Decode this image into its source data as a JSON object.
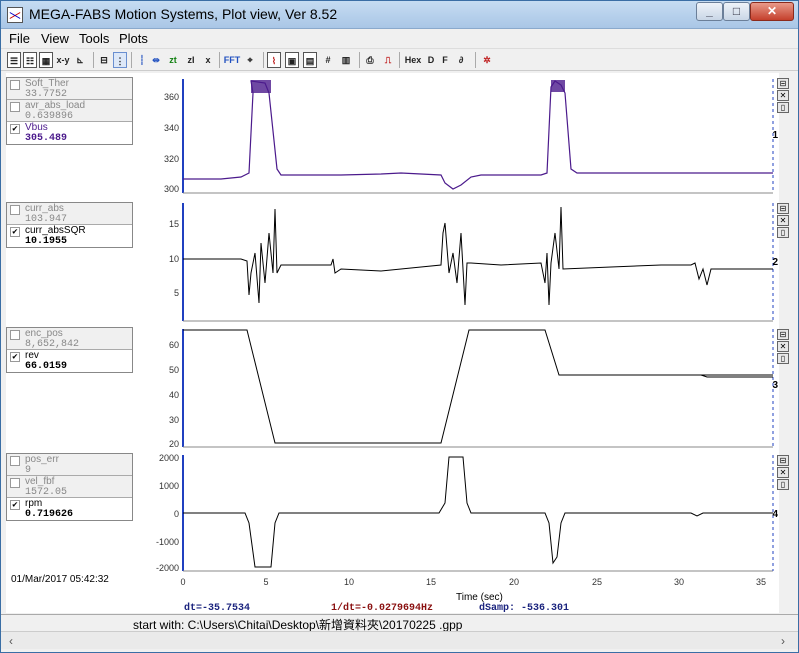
{
  "window": {
    "title": "MEGA-FABS Motion Systems, Plot view, Ver 8.52"
  },
  "menu": [
    "File",
    "View",
    "Tools",
    "Plots"
  ],
  "toolbar": {
    "xy": "x-y",
    "zt": "zt",
    "zi": "zI",
    "fft": "FFT",
    "hex": "Hex",
    "d": "D",
    "f": "F"
  },
  "plots": [
    {
      "number": "1",
      "signals": [
        {
          "name": "Soft_Ther",
          "value": "33.7752",
          "checked": false
        },
        {
          "name": "avr_abs_load",
          "value": "0.639896",
          "checked": false
        },
        {
          "name": "Vbus",
          "value": "305.489",
          "checked": true
        }
      ],
      "yticks": [
        "360",
        "340",
        "320",
        "300"
      ]
    },
    {
      "number": "2",
      "signals": [
        {
          "name": "curr_abs",
          "value": "103.947",
          "checked": false
        },
        {
          "name": "curr_absSQR",
          "value": "10.1955",
          "checked": true
        }
      ],
      "yticks": [
        "15",
        "10",
        "5"
      ]
    },
    {
      "number": "3",
      "signals": [
        {
          "name": "enc_pos",
          "value": "8,652,842",
          "checked": false
        },
        {
          "name": "rev",
          "value": "66.0159",
          "checked": true
        }
      ],
      "yticks": [
        "60",
        "50",
        "40",
        "30",
        "20"
      ]
    },
    {
      "number": "4",
      "signals": [
        {
          "name": "pos_err",
          "value": "9",
          "checked": false
        },
        {
          "name": "vel_fbf",
          "value": "1572.05",
          "checked": false
        },
        {
          "name": "rpm",
          "value": "0.719626",
          "checked": true
        }
      ],
      "yticks": [
        "2000",
        "1000",
        "0",
        "-1000",
        "-2000"
      ]
    }
  ],
  "xaxis": {
    "label": "Time (sec)",
    "ticks": [
      "0",
      "5",
      "10",
      "15",
      "20",
      "25",
      "30",
      "35"
    ]
  },
  "timestamp": "01/Mar/2017  05:42:32",
  "readout": {
    "dt": "dt=-35.7534",
    "inv_dt": "1/dt=-0.0279694Hz",
    "dsamp": "dSamp: -536.301"
  },
  "status": {
    "text": "start with: C:\\Users\\Chitai\\Desktop\\新增資料夾\\20170225        .gpp"
  },
  "colors": {
    "vbus": "#4b1a8c",
    "trace": "#000000",
    "cursor": "#2040c0",
    "inv_dt": "#8a1010"
  }
}
